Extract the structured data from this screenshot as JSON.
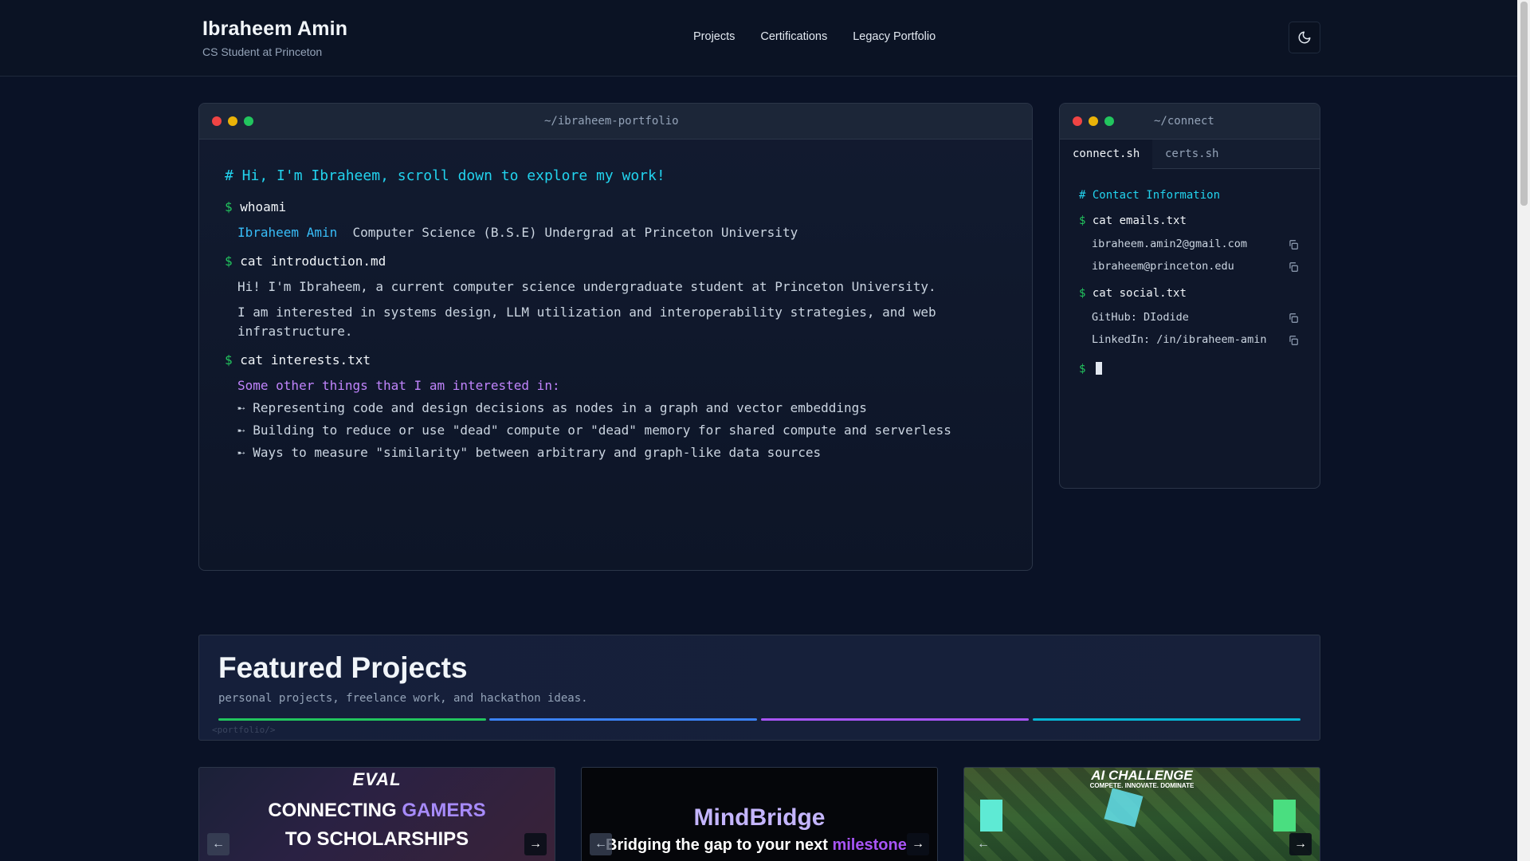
{
  "header": {
    "name": "Ibraheem Amin",
    "subtitle": "CS Student at Princeton",
    "nav": [
      "Projects",
      "Certifications",
      "Legacy Portfolio"
    ]
  },
  "main_terminal": {
    "title": "~/ibraheem-portfolio",
    "greeting": "# Hi, I'm Ibraheem, scroll down to explore my work!",
    "prompt": "$",
    "cmd_whoami": "whoami",
    "whoami_name": "Ibraheem Amin",
    "whoami_desc": "Computer Science (B.S.E) Undergrad at Princeton University",
    "cmd_intro": "cat introduction.md",
    "intro_1": "Hi! I'm Ibraheem, a current computer science undergraduate student at Princeton University.",
    "intro_2a": "I am interested in systems design, LLM utilization and interoperability strategies, and web",
    "intro_2b": "infrastructure.",
    "cmd_interests": "cat interests.txt",
    "interests_heading": "Some other things that I am interested in:",
    "bullet": "➸",
    "interests": [
      "Representing code and design decisions as nodes in a graph and vector embeddings",
      "Building to reduce or use \"dead\" compute or \"dead\" memory for shared compute and serverless",
      "Ways to measure \"similarity\" between arbitrary and graph-like data sources"
    ]
  },
  "side_terminal": {
    "title": "~/connect",
    "tabs": [
      "connect.sh",
      "certs.sh"
    ],
    "comment": "# Contact Information",
    "prompt": "$",
    "cmd_emails": "cat emails.txt",
    "emails": [
      "ibraheem.amin2@gmail.com",
      "ibraheem@princeton.edu"
    ],
    "cmd_social": "cat social.txt",
    "social": [
      "GitHub: DIodide",
      "LinkedIn: /in/ibraheem-amin"
    ]
  },
  "featured": {
    "title": "Featured Projects",
    "subtitle": "personal projects, freelance work, and hackathon ideas.",
    "ghost_tag": "<portfolio/>",
    "bar_colors": [
      "#22c55e",
      "#3b82f6",
      "#a855f7",
      "#06b6d4"
    ]
  },
  "cards": [
    {
      "logo": "EVAL",
      "line1a": "CONNECTING ",
      "line1b": "GAMERS",
      "line2": "TO SCHOLARSHIPS"
    },
    {
      "title": "MindBridge",
      "tagline_a": "Bridging the gap to your next ",
      "tagline_b": "milestone"
    },
    {
      "title": "AI CHALLENGE",
      "tagline": "COMPETE. INNOVATE. DOMINATE"
    }
  ]
}
